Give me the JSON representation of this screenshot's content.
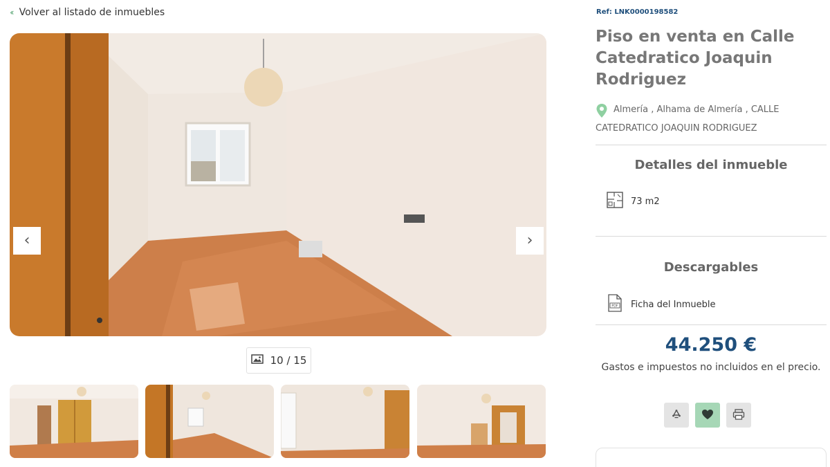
{
  "nav": {
    "back_label": "Volver al listado de inmuebles"
  },
  "gallery": {
    "counter": "10 / 15",
    "prev_icon": "chevron-left-icon",
    "next_icon": "chevron-right-icon",
    "thumbnails": [
      "thumb-1",
      "thumb-2",
      "thumb-3",
      "thumb-4"
    ]
  },
  "property": {
    "ref": "Ref: LNK0000198582",
    "title": "Piso en venta en Calle Catedratico Joaquin Rodriguez",
    "address_line1": "Almería , Alhama de Almería , CALLE",
    "address_line2": "CATEDRATICO JOAQUIN RODRIGUEZ"
  },
  "details": {
    "heading": "Detalles del inmueble",
    "area": "73 m2"
  },
  "downloads": {
    "heading": "Descargables",
    "item": "Ficha del Inmueble"
  },
  "pricing": {
    "price": "44.250 €",
    "note": "Gastos e impuestos no incluidos en el precio."
  },
  "colors": {
    "accent_green": "#5fa979",
    "brand_blue": "#1f4f7c",
    "favorite_bg": "#a6d7b6"
  }
}
